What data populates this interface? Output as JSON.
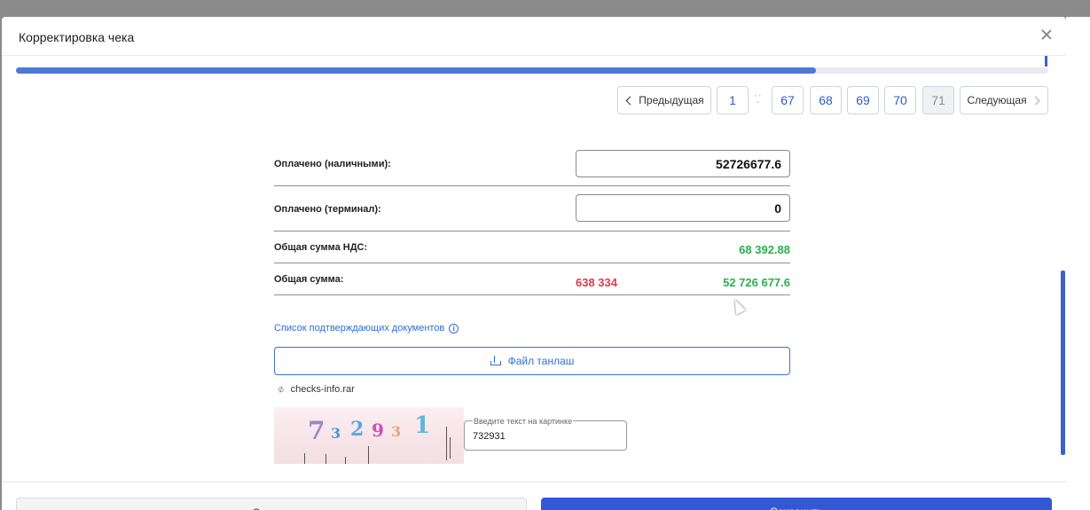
{
  "modal": {
    "title": "Корректировка чека"
  },
  "progress": {
    "value": 0.775
  },
  "pagination": {
    "prev_label": "Предыдущая",
    "next_label": "Следующая",
    "pages": [
      "1",
      "67",
      "68",
      "69",
      "70",
      "71"
    ],
    "ellipsis": "··",
    "current": "71"
  },
  "form": {
    "paid_cash_label": "Оплачено (наличными):",
    "paid_cash_value": "52726677.6",
    "paid_terminal_label": "Оплачено (терминал):",
    "paid_terminal_value": "0",
    "vat_total_label": "Общая сумма НДС:",
    "vat_total_value": "68 392.88",
    "total_label": "Общая сумма:",
    "total_red_value": "638 334",
    "total_green_value": "52 726 677.6"
  },
  "documents": {
    "link_label": "Список подтверждающих документов",
    "info_icon": "i",
    "upload_label": "Файл танлаш",
    "file_name": "checks-info.rar"
  },
  "captcha": {
    "image_text": "732931",
    "field_label": "Введите текст на картинке",
    "field_value": "732931"
  },
  "footer": {
    "cancel_label": "Отмена",
    "save_label": "Сохранить"
  },
  "colors": {
    "accent": "#3358d4",
    "positive": "#2cae4c",
    "negative": "#e0394f"
  }
}
